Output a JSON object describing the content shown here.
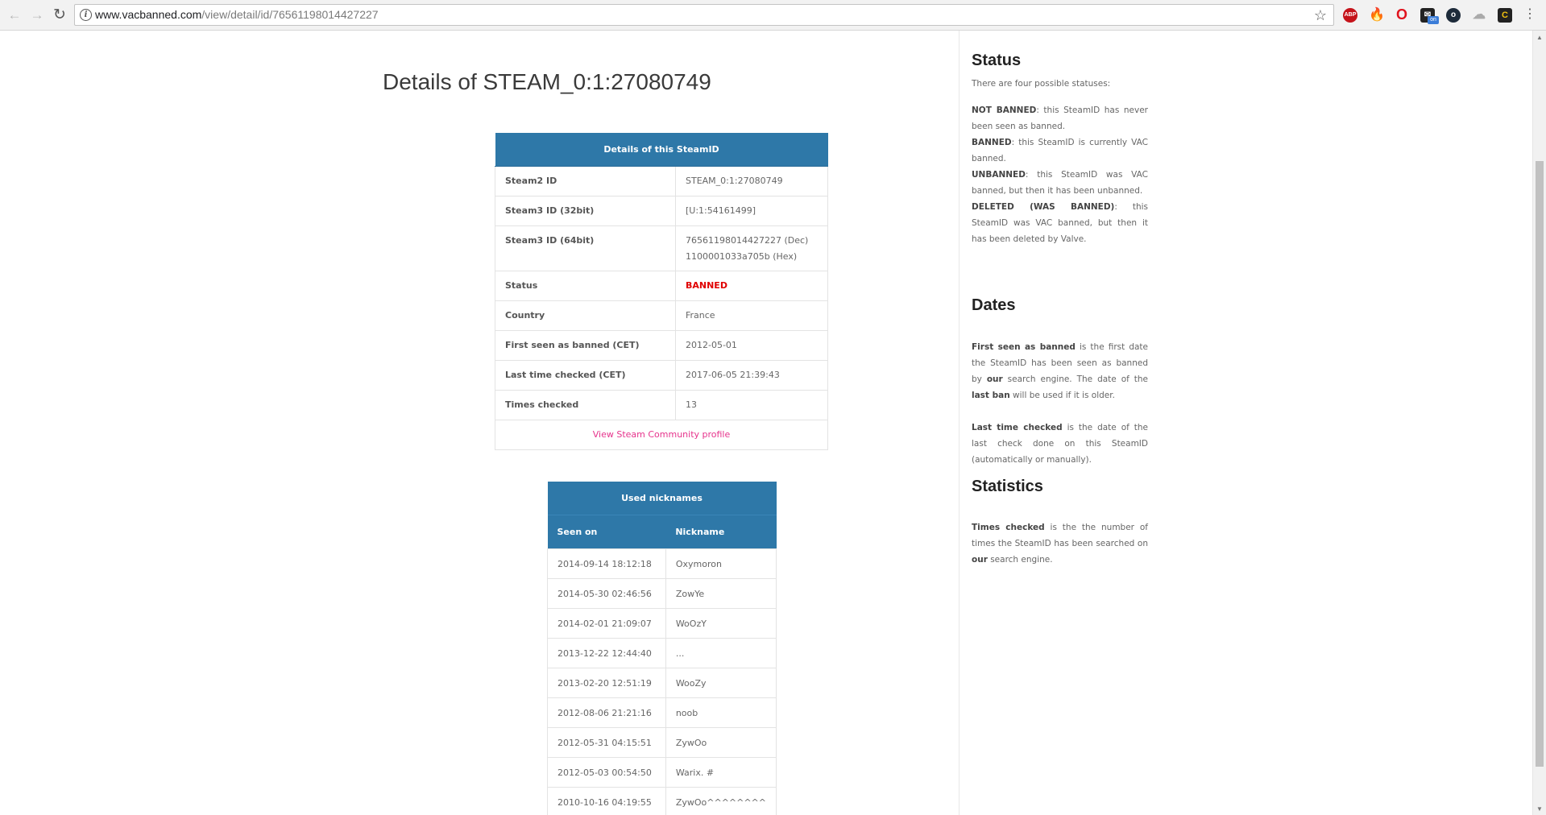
{
  "browser": {
    "url_host": "www.vacbanned.com",
    "url_path": "/view/detail/id/76561198014427227",
    "extensions": [
      {
        "name": "adblock-plus-icon",
        "label": "ABP"
      },
      {
        "name": "fire-icon",
        "label": "🔥"
      },
      {
        "name": "opera-icon",
        "label": "O"
      },
      {
        "name": "mail-icon",
        "label": "✉"
      },
      {
        "name": "circle-icon",
        "label": "o"
      },
      {
        "name": "cloud-icon",
        "label": "☁"
      },
      {
        "name": "c-icon",
        "label": "C"
      }
    ],
    "mail_badge": "on"
  },
  "page": {
    "title": "Details of STEAM_0:1:27080749"
  },
  "details": {
    "caption": "Details of this SteamID",
    "steam2_label": "Steam2 ID",
    "steam2_value": "STEAM_0:1:27080749",
    "steam3_32_label": "Steam3 ID (32bit)",
    "steam3_32_value": "[U:1:54161499]",
    "steam3_64_label": "Steam3 ID (64bit)",
    "steam3_64_dec": "76561198014427227 (Dec)",
    "steam3_64_hex": "1100001033a705b (Hex)",
    "status_label": "Status",
    "status_value": "BANNED",
    "country_label": "Country",
    "country_value": "France",
    "first_seen_label": "First seen as banned (CET)",
    "first_seen_value": "2012-05-01",
    "last_checked_label": "Last time checked (CET)",
    "last_checked_value": "2017-06-05 21:39:43",
    "times_checked_label": "Times checked",
    "times_checked_value": "13",
    "profile_link": "View Steam Community profile",
    "status_color": "#e00000",
    "header_color": "#2e78a8",
    "link_color": "#e6338c"
  },
  "nicknames": {
    "caption": "Used nicknames",
    "col_seen": "Seen on",
    "col_nick": "Nickname",
    "rows": [
      {
        "seen": "2014-09-14 18:12:18",
        "nick": "Oxymoron"
      },
      {
        "seen": "2014-05-30 02:46:56",
        "nick": "ZowYe"
      },
      {
        "seen": "2014-02-01 21:09:07",
        "nick": "WoOzY"
      },
      {
        "seen": "2013-12-22 12:44:40",
        "nick": "..."
      },
      {
        "seen": "2013-02-20 12:51:19",
        "nick": "WooZy"
      },
      {
        "seen": "2012-08-06 21:21:16",
        "nick": "noob"
      },
      {
        "seen": "2012-05-31 04:15:51",
        "nick": "ZywOo"
      },
      {
        "seen": "2012-05-03 00:54:50",
        "nick": "Warix. #"
      },
      {
        "seen": "2010-10-16 04:19:55",
        "nick": "ZywOo^^^^^^^^"
      }
    ]
  },
  "sidebar": {
    "status_heading": "Status",
    "status_intro": "There are four possible statuses:",
    "not_banned_term": "NOT BANNED",
    "not_banned_desc": ": this SteamID has never been seen as banned.",
    "banned_term": "BANNED",
    "banned_desc": ": this SteamID is currently VAC banned.",
    "unbanned_term": "UNBANNED",
    "unbanned_desc": ": this SteamID was VAC banned, but then it has been unbanned.",
    "deleted_term": "DELETED (WAS BANNED)",
    "deleted_desc": ": this SteamID was VAC banned, but then it has been deleted by Valve.",
    "dates_heading": "Dates",
    "first_seen_term": "First seen as banned",
    "first_seen_desc_a": " is the first date the SteamID has been seen as banned by ",
    "our_word": "our",
    "first_seen_desc_b": " search engine. The date of the ",
    "last_ban_term": "last ban",
    "first_seen_desc_c": " will be used if it is older.",
    "last_checked_term": "Last time checked",
    "last_checked_desc": " is the date of the last check done on this SteamID (automatically or manually).",
    "statistics_heading": "Statistics",
    "times_checked_term": "Times checked",
    "times_checked_desc_a": " is the the number of times the SteamID has been searched on ",
    "times_checked_desc_b": " search engine."
  }
}
